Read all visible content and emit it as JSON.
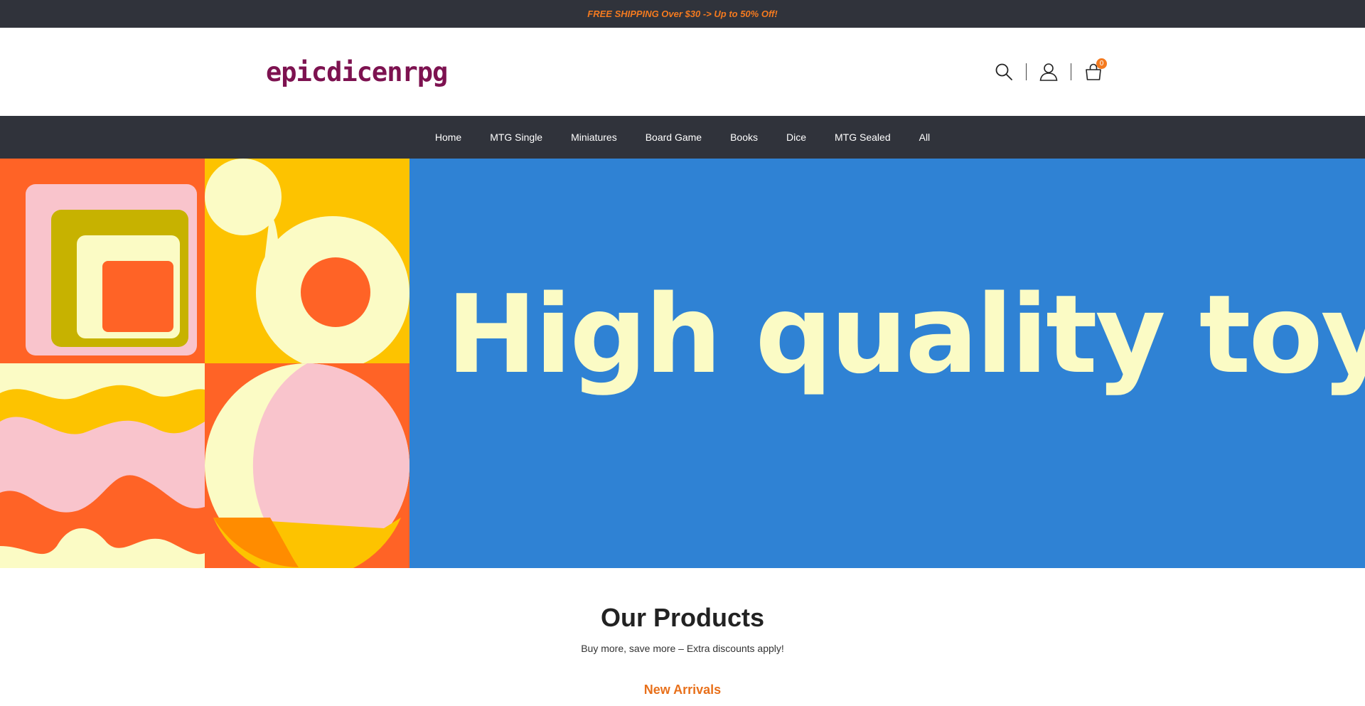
{
  "announcement": {
    "text": "FREE SHIPPING Over $30 -> Up to 50% Off!",
    "color": "#f47a1f"
  },
  "header": {
    "logo_text": "epicdicenrpg",
    "logo_color": "#7d1250",
    "icons": [
      "search-icon",
      "account-icon",
      "cart-icon"
    ],
    "cart_count": "0"
  },
  "nav": {
    "items": [
      {
        "label": "Home"
      },
      {
        "label": "MTG Single"
      },
      {
        "label": "Miniatures"
      },
      {
        "label": "Board Game"
      },
      {
        "label": "Books"
      },
      {
        "label": "Dice"
      },
      {
        "label": "MTG Sealed"
      },
      {
        "label": "All"
      }
    ],
    "background": "#30333b"
  },
  "hero": {
    "title": "High quality toys",
    "background": "#2f82d4",
    "title_color": "#fbfbc5"
  },
  "products": {
    "heading": "Our Products",
    "subtitle": "Buy more, save more – Extra discounts apply!",
    "tab_label": "New Arrivals",
    "tab_color": "#e8701b"
  }
}
